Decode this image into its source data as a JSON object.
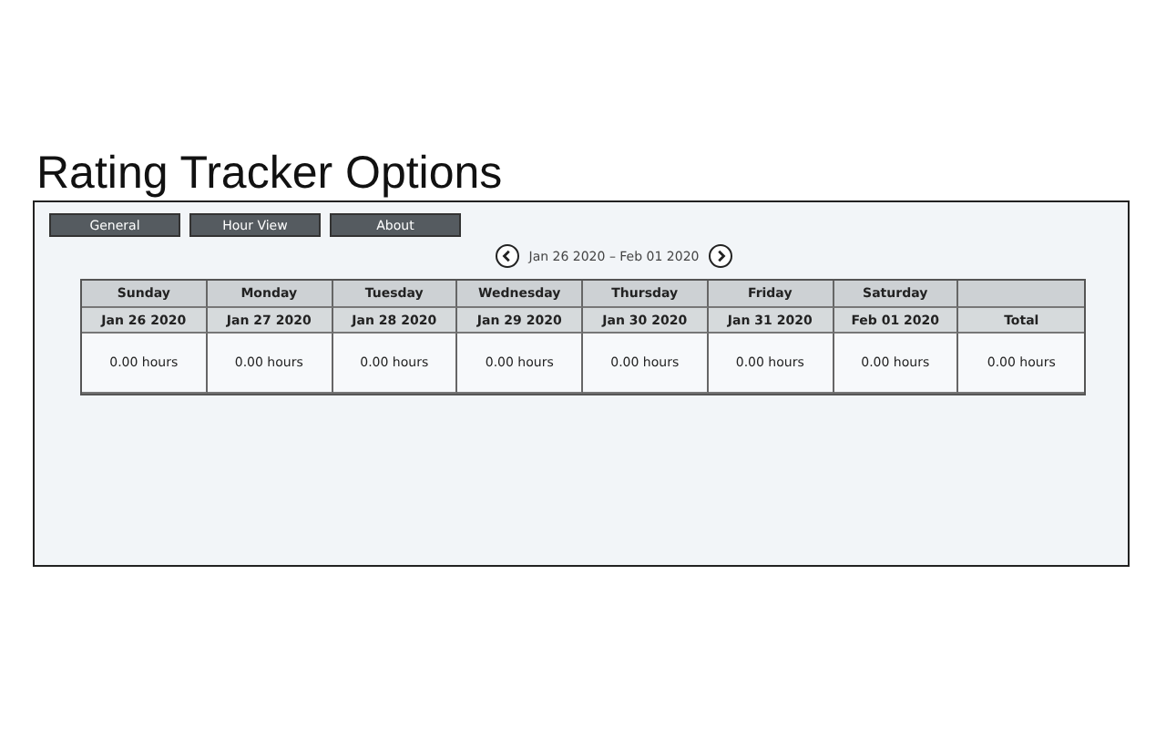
{
  "title": "Rating Tracker Options",
  "tabs": [
    {
      "label": "General"
    },
    {
      "label": "Hour View"
    },
    {
      "label": "About"
    }
  ],
  "range": "Jan 26 2020 – Feb 01 2020",
  "columns": [
    {
      "day": "Sunday",
      "date": "Jan 26 2020",
      "hours": "0.00 hours"
    },
    {
      "day": "Monday",
      "date": "Jan 27 2020",
      "hours": "0.00 hours"
    },
    {
      "day": "Tuesday",
      "date": "Jan 28 2020",
      "hours": "0.00 hours"
    },
    {
      "day": "Wednesday",
      "date": "Jan 29 2020",
      "hours": "0.00 hours"
    },
    {
      "day": "Thursday",
      "date": "Jan 30 2020",
      "hours": "0.00 hours"
    },
    {
      "day": "Friday",
      "date": "Jan 31 2020",
      "hours": "0.00 hours"
    },
    {
      "day": "Saturday",
      "date": "Feb 01 2020",
      "hours": "0.00 hours"
    },
    {
      "date": "Total",
      "hours": "0.00 hours"
    }
  ]
}
